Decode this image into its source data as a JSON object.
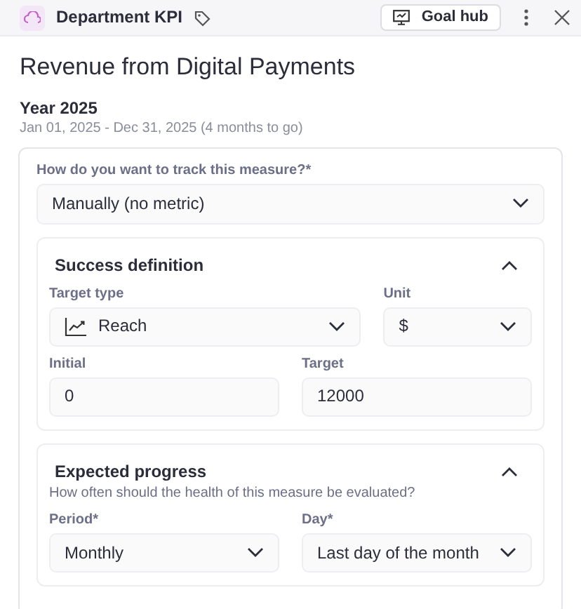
{
  "header": {
    "title": "Department KPI",
    "button": "Goal hub"
  },
  "title": "Revenue from Digital Payments",
  "period": {
    "heading": "Year 2025",
    "range": "Jan 01, 2025 - Dec 31, 2025 (4 months to go)"
  },
  "tracking": {
    "label": "How do you want to track this measure?*",
    "value": "Manually (no metric)"
  },
  "sections": [
    {
      "title": "Success definition",
      "expanded": true,
      "rows": [
        [
          {
            "label": "Target type",
            "value": "Reach",
            "kind": "trend-select"
          },
          {
            "label": "Unit",
            "value": "$",
            "kind": "select"
          }
        ],
        [
          {
            "label": "Initial",
            "value": "0",
            "kind": "input"
          },
          {
            "label": "Target",
            "value": "12000",
            "kind": "input"
          }
        ]
      ]
    },
    {
      "title": "Expected progress",
      "expanded": true,
      "hint": "How often should the health of this measure be evaluated?",
      "rows": [
        [
          {
            "label": "Period*",
            "value": "Monthly",
            "kind": "select"
          },
          {
            "label": "Day*",
            "value": "Last day of the month",
            "kind": "select"
          }
        ]
      ]
    }
  ]
}
